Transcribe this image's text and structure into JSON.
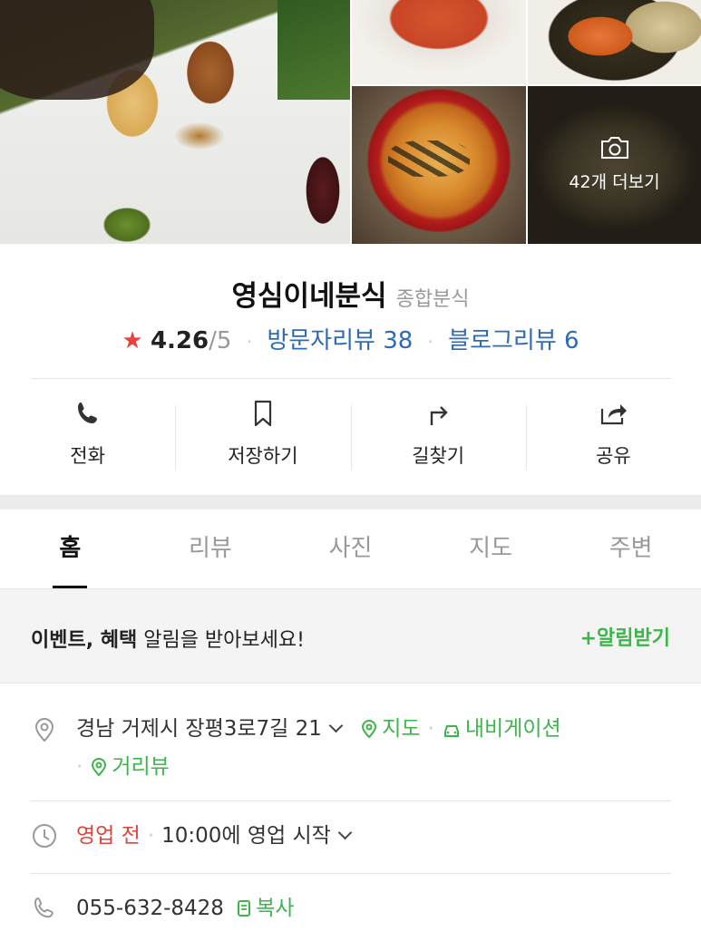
{
  "photos": {
    "more_label": "42개 더보기"
  },
  "place": {
    "name": "영심이네분식",
    "category": "종합분식",
    "rating": "4.26",
    "rating_max": "/5",
    "visitor_reviews": "방문자리뷰 38",
    "blog_reviews": "블로그리뷰 6"
  },
  "actions": {
    "call": "전화",
    "save": "저장하기",
    "directions": "길찾기",
    "share": "공유"
  },
  "tabs": [
    "홈",
    "리뷰",
    "사진",
    "지도",
    "주변"
  ],
  "banner": {
    "bold": "이벤트, 혜택",
    "rest": " 알림을 받아보세요!",
    "button": "+알림받기"
  },
  "details": {
    "address": "경남 거제시 장평3로7길 21",
    "map_link": "지도",
    "navigation_link": "내비게이션",
    "streetview_link": "거리뷰",
    "status": "영업 전",
    "open_time": "10:00에 영업 시작",
    "phone": "055-632-8428",
    "copy": "복사"
  },
  "colors": {
    "accent_green": "#3cb54a",
    "link_blue": "#2e6bb5",
    "star_red": "#e8423a"
  }
}
